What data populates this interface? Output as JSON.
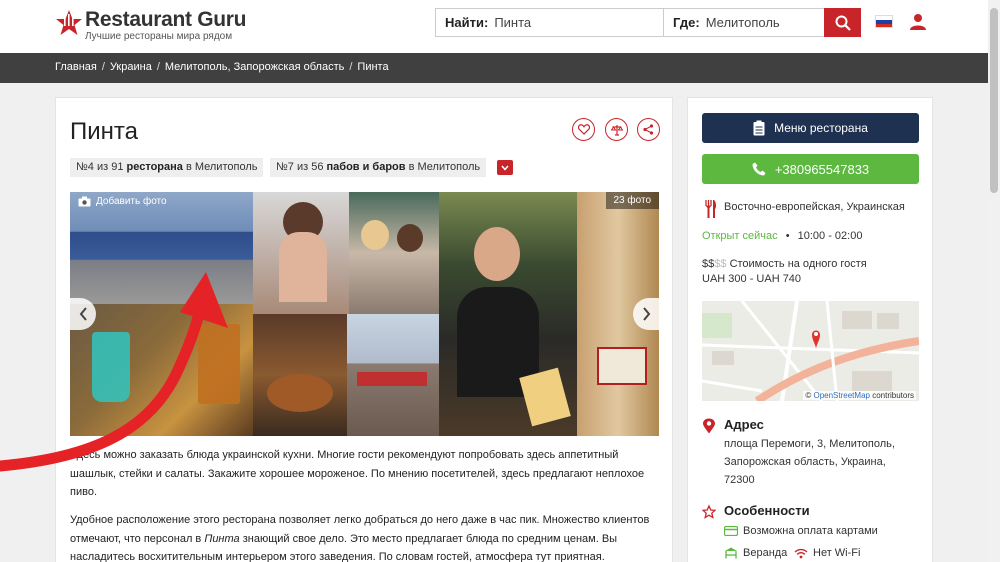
{
  "header": {
    "logo_title": "Restaurant Guru",
    "logo_tagline": "Лучшие рестораны мира рядом",
    "search_what_label": "Найти:",
    "search_what_value": "Пинта",
    "search_where_label": "Где:",
    "search_where_value": "Мелитополь"
  },
  "breadcrumb": [
    "Главная",
    "Украина",
    "Мелитополь, Запорожская область",
    "Пинта"
  ],
  "restaurant": {
    "name": "Пинта",
    "rank1": {
      "pre": "№4 из 91 ",
      "bold": "ресторана",
      "post": " в Мелитополь"
    },
    "rank2": {
      "pre": "№7 из 56 ",
      "bold": "пабов и баров",
      "post": " в Мелитополь"
    }
  },
  "gallery": {
    "add_photo": "Добавить фото",
    "count": "23 фото"
  },
  "description": {
    "p1": "Здесь можно заказать блюда украинской кухни. Многие гости рекомендуют попробовать здесь аппетитный шашлык, стейки и салаты. Закажите хорошее мороженое. По мнению посетителей, здесь предлагают неплохое пиво.",
    "p2a": "Удобное расположение этого ресторана позволяет легко добраться до него даже в час пик. Множество клиентов отмечают, что персонал в ",
    "p2b": "Пинта",
    "p2c": " знающий свое дело. Это место предлагает блюда по средним ценам. Вы насладитесь восхитительным интерьером этого заведения. По словам гостей, атмосфера тут приятная."
  },
  "sidebar": {
    "menu_button": "Меню ресторана",
    "phone_button": "+380965547833",
    "cuisine": "Восточно-европейская, Украинская",
    "open_now": "Открыт сейчас",
    "hours_sep": "•",
    "hours": "10:00 - 02:00",
    "price_active": "$$",
    "price_inactive": "$$",
    "price_label": "Стоимость на одного гостя",
    "price_range": "UAH 300 - UAH 740",
    "map_credit_prefix": "©",
    "map_credit_link": "OpenStreetMap",
    "map_credit_suffix": "contributors",
    "address_title": "Адрес",
    "address_text": "площа Перемоги, 3, Мелитополь, Запорожская область, Украина, 72300",
    "features_title": "Особенности",
    "feature_card": "Возможна оплата картами",
    "feature_veranda": "Веранда",
    "feature_wifi": "Нет Wi-Fi"
  },
  "colors": {
    "brand_red": "#c8252b",
    "navy": "#1f3150",
    "green": "#5cb83f",
    "breadcrumb_bg": "#404040"
  }
}
